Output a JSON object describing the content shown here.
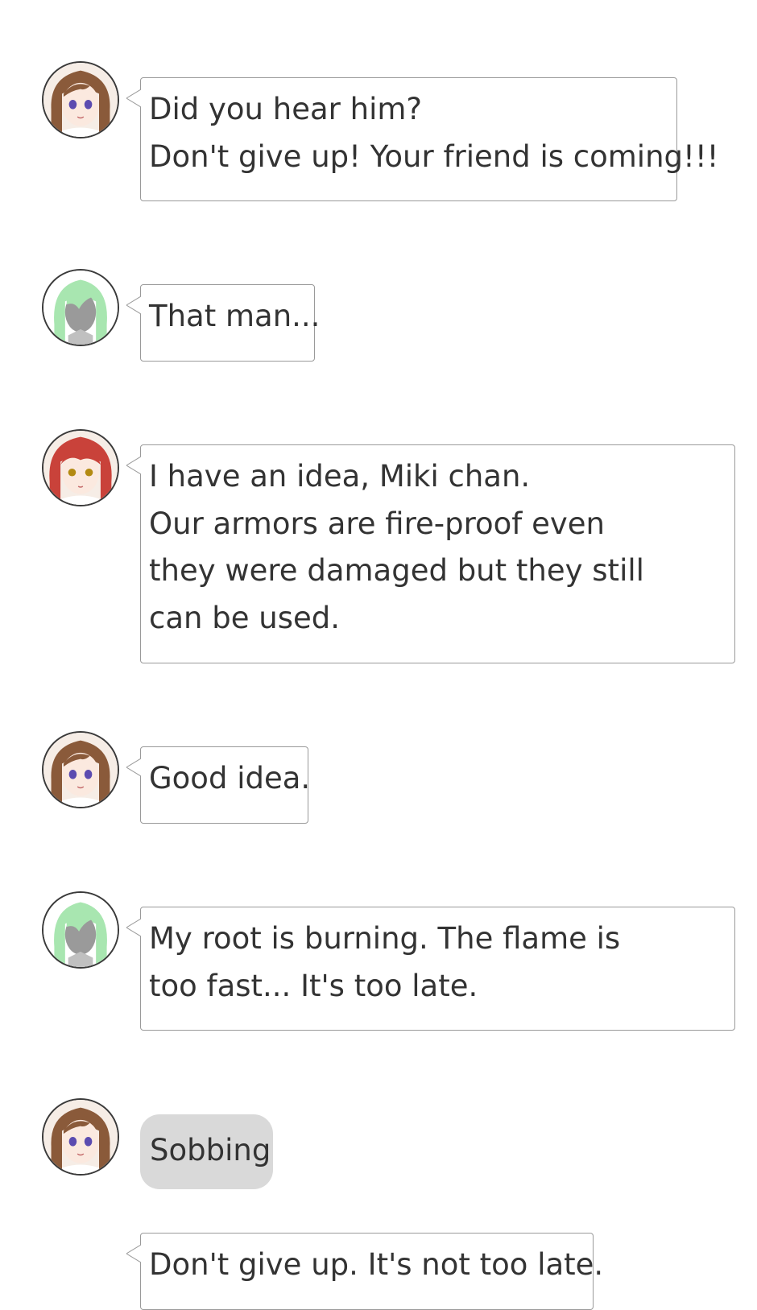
{
  "messages": [
    {
      "speaker_icon": "brown-hair-girl-avatar",
      "lines": [
        "Did you hear him?",
        "Don't give up! Your friend is coming!!!"
      ]
    },
    {
      "speaker_icon": "green-hair-faceless-avatar",
      "lines": [
        "That man..."
      ]
    },
    {
      "speaker_icon": "red-hair-girl-avatar",
      "lines": [
        "I have an idea, Miki chan.",
        "Our armors are fire-proof even they were damaged but they still can be used."
      ]
    },
    {
      "speaker_icon": "brown-hair-girl-avatar",
      "lines": [
        "Good idea."
      ]
    },
    {
      "speaker_icon": "green-hair-faceless-avatar",
      "lines": [
        "My root is burning. The flame is too fast... It's too late."
      ]
    },
    {
      "speaker_icon": "brown-hair-girl-avatar",
      "type": "action",
      "lines": [
        "Sobbing"
      ]
    },
    {
      "speaker_icon": "none",
      "lines": [
        "Don't give up. It's not too late."
      ]
    }
  ],
  "colors": {
    "background": "#ffffff",
    "text": "#333333",
    "bubble_border": "#9a9a9a",
    "action_bubble": "#d9d9d9",
    "avatar_border": "#3a3a3a"
  }
}
